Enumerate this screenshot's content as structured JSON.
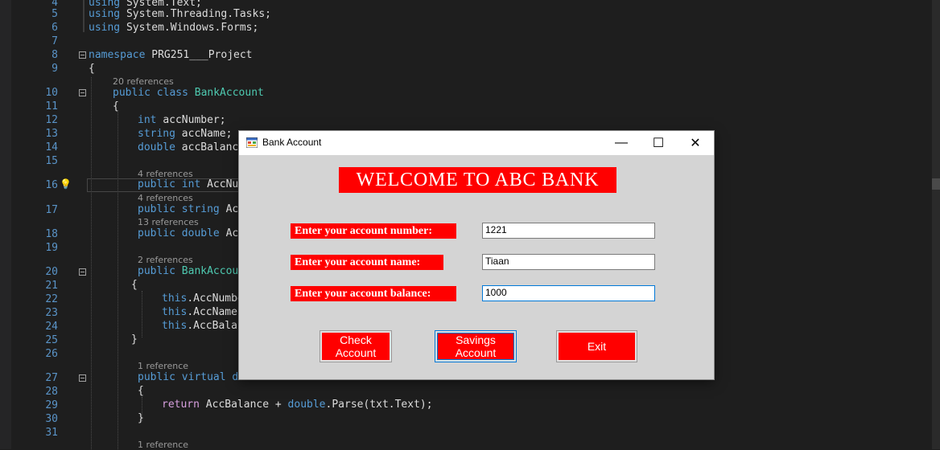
{
  "editor": {
    "lines": [
      {
        "n": "4",
        "t": [
          [
            "kw",
            "using"
          ],
          [
            "",
            "System.Text;"
          ]
        ]
      },
      {
        "n": "5",
        "t": [
          [
            "kw",
            "using"
          ],
          [
            "",
            "System.Threading.Tasks;"
          ]
        ]
      },
      {
        "n": "6",
        "t": [
          [
            "kw",
            "using"
          ],
          [
            "",
            "System.Windows.Forms;"
          ]
        ]
      },
      {
        "n": "7",
        "t": []
      },
      {
        "n": "8",
        "t": [
          [
            "kw",
            "namespace"
          ],
          [
            "",
            "PRG251___Project"
          ]
        ]
      },
      {
        "n": "9",
        "t": [
          [
            "",
            "{"
          ]
        ]
      },
      {
        "n": "10",
        "t": [
          [
            "kw",
            "public class"
          ],
          [
            "ty",
            "BankAccount"
          ]
        ]
      },
      {
        "n": "11",
        "t": [
          [
            "",
            "{"
          ]
        ]
      },
      {
        "n": "12",
        "t": [
          [
            "kw",
            "int"
          ],
          [
            "",
            "accNumber;"
          ]
        ]
      },
      {
        "n": "13",
        "t": [
          [
            "kw",
            "string"
          ],
          [
            "",
            "accName;"
          ]
        ]
      },
      {
        "n": "14",
        "t": [
          [
            "kw",
            "double"
          ],
          [
            "",
            "accBalance"
          ]
        ]
      },
      {
        "n": "15",
        "t": []
      },
      {
        "n": "16",
        "t": [
          [
            "kw",
            "public int"
          ],
          [
            "",
            "AccNum"
          ]
        ]
      },
      {
        "n": "17",
        "t": [
          [
            "kw",
            "public string"
          ],
          [
            "",
            "Acc"
          ]
        ]
      },
      {
        "n": "18",
        "t": [
          [
            "kw",
            "public double"
          ],
          [
            "",
            "Acc"
          ]
        ]
      },
      {
        "n": "19",
        "t": []
      },
      {
        "n": "20",
        "t": [
          [
            "kw",
            "public"
          ],
          [
            "ty",
            "BankAccour"
          ]
        ]
      },
      {
        "n": "21",
        "t": [
          [
            "",
            "{"
          ]
        ]
      },
      {
        "n": "22",
        "t": [
          [
            "kw",
            "this"
          ],
          [
            "",
            ".AccNumbe"
          ]
        ]
      },
      {
        "n": "23",
        "t": [
          [
            "kw",
            "this"
          ],
          [
            "",
            ".AccName"
          ]
        ]
      },
      {
        "n": "24",
        "t": [
          [
            "kw",
            "this"
          ],
          [
            "",
            ".AccBalar"
          ]
        ]
      },
      {
        "n": "25",
        "t": [
          [
            "",
            "}"
          ]
        ]
      },
      {
        "n": "26",
        "t": []
      },
      {
        "n": "27",
        "t": [
          [
            "kw",
            "public virtual"
          ],
          [
            "kw",
            "do"
          ]
        ]
      },
      {
        "n": "28",
        "t": [
          [
            "",
            "{"
          ]
        ]
      },
      {
        "n": "29",
        "t": [
          [
            "ctl",
            "return"
          ],
          [
            "",
            "AccBalance + "
          ],
          [
            "kw",
            "double"
          ],
          [
            "",
            ".Parse(txt.Text);"
          ]
        ]
      },
      {
        "n": "30",
        "t": [
          [
            "",
            "}"
          ]
        ]
      },
      {
        "n": "31",
        "t": []
      }
    ],
    "references": [
      "20 references",
      "4 references",
      "4 references",
      "13 references",
      "2 references",
      "1 reference",
      "1 reference"
    ]
  },
  "dialog": {
    "title": "Bank Account",
    "minimize": "—",
    "maximize": "☐",
    "close": "✕",
    "banner": "WELCOME TO ABC BANK",
    "labels": {
      "number": "Enter your account number:",
      "name": "Enter your account name:",
      "balance": "Enter your account balance:"
    },
    "fields": {
      "number": "1221",
      "name": "Tiaan",
      "balance": "1000"
    },
    "buttons": {
      "check": "Check\nAccount",
      "savings": "Savings\nAccount",
      "exit": "Exit"
    }
  },
  "colors": {
    "accent_red": "#ff0000",
    "editor_bg": "#1e1e1e",
    "dialog_bg": "#d4d4d4"
  }
}
